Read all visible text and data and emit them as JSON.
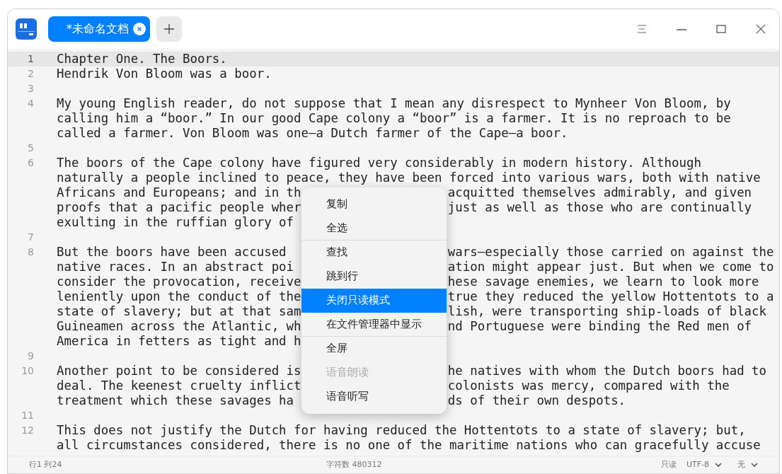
{
  "tabs": [
    {
      "label": "*未命名文档",
      "selected": true
    }
  ],
  "lines": [
    {
      "number": "1",
      "current": true,
      "rows": [
        {
          "text": "Chapter One. The Boors."
        }
      ]
    },
    {
      "number": "2",
      "current": false,
      "rows": [
        {
          "text": "Hendrik Von Bloom was a boor."
        }
      ]
    },
    {
      "number": "3",
      "current": false
    },
    {
      "number": "4",
      "current": false,
      "rows": [
        {
          "text": "My young English reader, do not suppose that I mean any disrespect to Mynheer Von Bloom, by"
        },
        {
          "text": "calling him a “boor.” In our good Cape colony a “boor” is a farmer. It is no reproach to be"
        },
        {
          "text": "called a farmer. Von Bloom was one—a Dutch farmer of the Cape—a boor."
        }
      ]
    },
    {
      "number": "5",
      "current": false
    },
    {
      "number": "6",
      "current": false,
      "rows": [
        {
          "text": "The boors of the Cape colony have figured very considerably in modern history. Although"
        },
        {
          "text": "naturally a people inclined to peace, they have been forced into various wars, both with native"
        },
        {
          "text": "Africans and Europeans; and in th",
          "after": "acquitted themselves admirably, and given"
        },
        {
          "text": "proofs that a pacific people wher",
          "after": "just as well as those who are continually"
        },
        {
          "text": "exulting in the ruffian glory of"
        }
      ]
    },
    {
      "number": "7",
      "current": false
    },
    {
      "number": "8",
      "current": false,
      "rows": [
        {
          "text": "But the boors have been accused",
          "after": "wars—especially those carried on against the"
        },
        {
          "text": "native races. In an abstract poi",
          "after": "ation might appear just. But when we come to"
        },
        {
          "text": "consider the provocation, receive",
          "after": "hese savage enemies, we learn to look more"
        },
        {
          "text": "leniently upon the conduct of the",
          "after": "true they reduced the yellow Hottentots to a"
        },
        {
          "text": "state of slavery; but at that sam",
          "after": "lish, were transporting ship-loads of black"
        },
        {
          "text": "Guineamen across the Atlantic, wh",
          "after": "nd Portuguese were binding the Red men of"
        },
        {
          "text": "America in fetters as tight and h"
        }
      ]
    },
    {
      "number": "9",
      "current": false
    },
    {
      "number": "10",
      "current": false,
      "rows": [
        {
          "text": "Another point to be considered is",
          "after": "he natives with whom the Dutch boors had to"
        },
        {
          "text": "deal. The keenest cruelty inflict",
          "after": "colonists was mercy, compared with the"
        },
        {
          "text": "treatment which these savages ha",
          "after": "ds of their own despots."
        }
      ]
    },
    {
      "number": "11",
      "current": false
    },
    {
      "number": "12",
      "current": false,
      "rows": [
        {
          "text": "This does not justify the Dutch for having reduced the Hottentots to a state of slavery; but,"
        },
        {
          "text": "all circumstances considered, there is no one of the maritime nations who can gracefully accuse"
        }
      ]
    }
  ],
  "context_menu": [
    {
      "label": "复制",
      "selected": false,
      "disabled": false,
      "separator_after": false
    },
    {
      "label": "全选",
      "selected": false,
      "disabled": false,
      "separator_after": true
    },
    {
      "label": "查找",
      "selected": false,
      "disabled": false,
      "separator_after": false
    },
    {
      "label": "跳到行",
      "selected": false,
      "disabled": false,
      "separator_after": false
    },
    {
      "label": "关闭只读模式",
      "selected": true,
      "disabled": false,
      "separator_after": false
    },
    {
      "label": "在文件管理器中显示",
      "selected": false,
      "disabled": false,
      "separator_after": true
    },
    {
      "label": "全屏",
      "selected": false,
      "disabled": false,
      "separator_after": false
    },
    {
      "label": "语音朗读",
      "selected": false,
      "disabled": true,
      "separator_after": false
    },
    {
      "label": "语音听写",
      "selected": false,
      "disabled": false,
      "separator_after": false
    }
  ],
  "status_bar": {
    "position": "行1 列24",
    "char_count": "字符数 480312",
    "mode": "只读",
    "encoding": "UTF-8",
    "highlight": "无"
  }
}
